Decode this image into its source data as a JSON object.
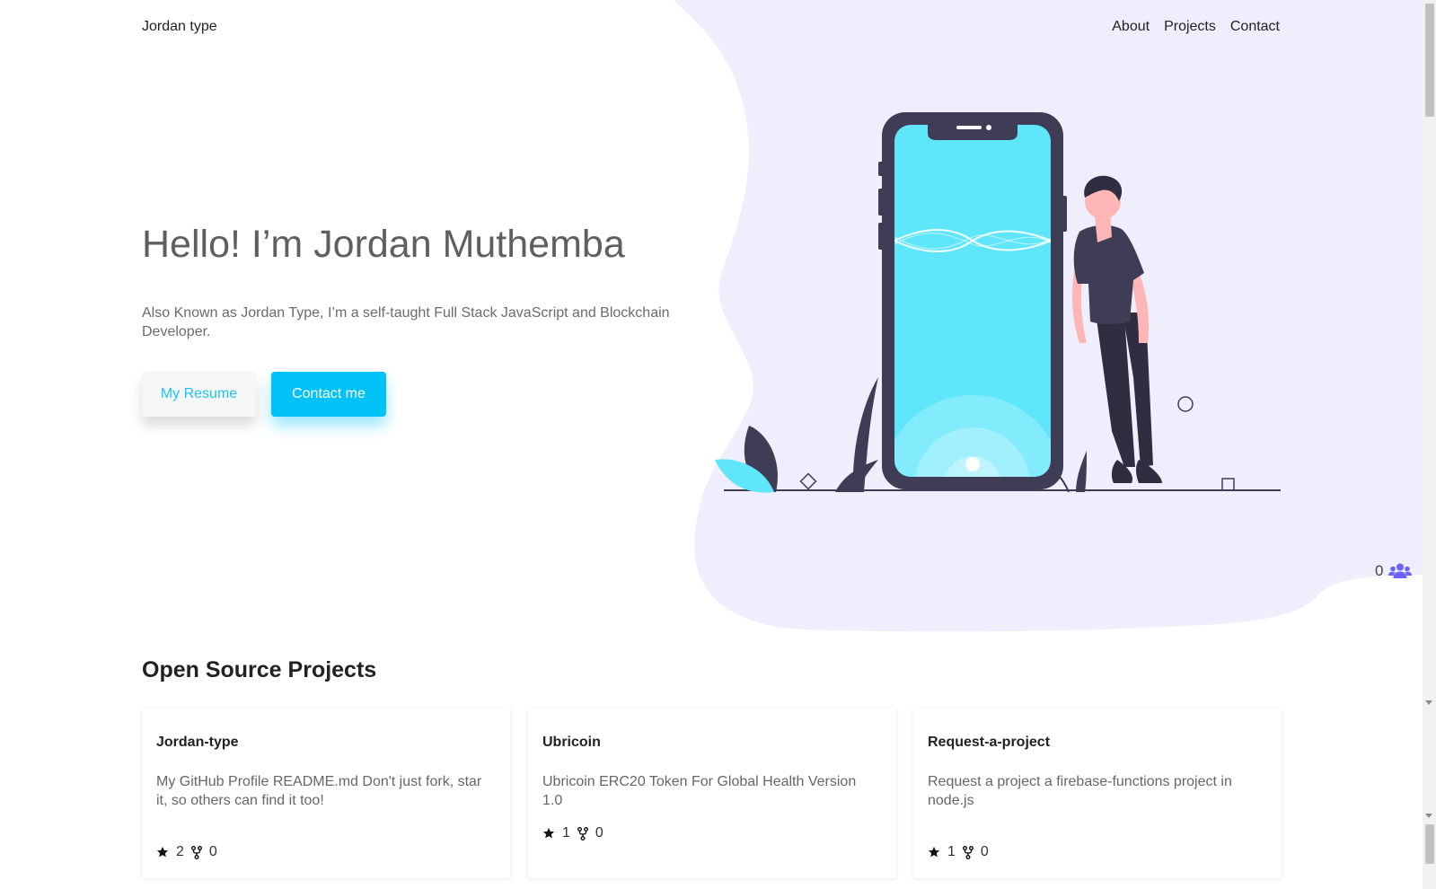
{
  "brand": "Jordan type",
  "nav": {
    "about": "About",
    "projects": "Projects",
    "contact": "Contact"
  },
  "hero": {
    "title": "Hello! I’m Jordan Muthemba",
    "subtitle": "Also Known as Jordan Type, I’m a self-taught Full Stack JavaScript and Blockchain Developer.",
    "resume_button": "My Resume",
    "contact_button": "Contact me"
  },
  "counter": {
    "value": "0",
    "icon": "users-icon"
  },
  "projects": {
    "title": "Open Source Projects",
    "items": [
      {
        "name": "Jordan-type",
        "description": "My GitHub Profile README.md Don't just fork, star it, so others can find it too!",
        "stars": "2",
        "forks": "0"
      },
      {
        "name": "Ubricoin",
        "description": "Ubricoin ERC20 Token For Global Health Version 1.0",
        "stars": "1",
        "forks": "0"
      },
      {
        "name": "Request-a-project",
        "description": "Request a project a firebase-functions project in node.js",
        "stars": "1",
        "forks": "0"
      }
    ]
  },
  "colors": {
    "accent": "#00c2f7",
    "blob": "#efeefc",
    "dark": "#3f3d56",
    "screen": "#5fe6fb",
    "skin": "#ffb6b6"
  }
}
